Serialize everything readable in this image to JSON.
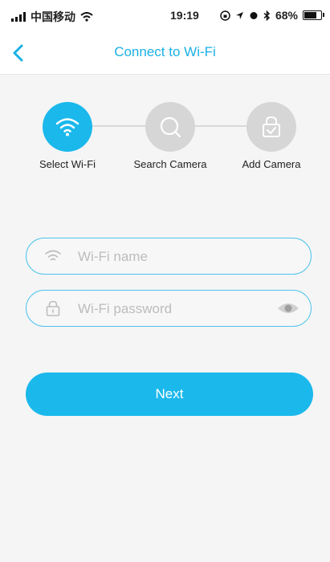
{
  "status_bar": {
    "carrier": "中国移动",
    "time": "19:19",
    "battery": "68%",
    "battery_level": 0.68
  },
  "nav": {
    "back_icon": "chevron-left-icon",
    "title": "Connect to Wi-Fi"
  },
  "steps": [
    {
      "label": "Select Wi-Fi",
      "icon": "wifi-icon",
      "active": true
    },
    {
      "label": "Search Camera",
      "icon": "search-icon",
      "active": false
    },
    {
      "label": "Add Camera",
      "icon": "lock-check-icon",
      "active": false
    }
  ],
  "form": {
    "wifi_name": {
      "placeholder": "Wi-Fi name",
      "value": "",
      "icon": "wifi-icon"
    },
    "wifi_password": {
      "placeholder": "Wi-Fi password",
      "value": "",
      "icon": "lock-icon",
      "toggle_icon": "eye-icon"
    }
  },
  "next_button": {
    "label": "Next"
  },
  "colors": {
    "accent": "#1bb8ec",
    "title": "#1ab0e6",
    "inactive_step": "#d6d6d6",
    "field_border": "#4cc4ec"
  }
}
